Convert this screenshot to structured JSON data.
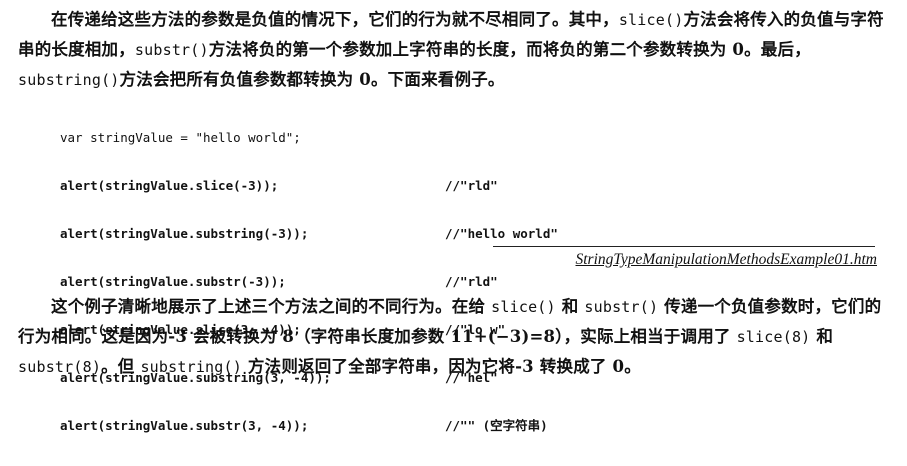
{
  "paragraph1": {
    "t1": "在传递给这些方法的参数是负值的情况下，它们的行为就不尽相同了。其中，",
    "c1": "slice()",
    "t2": "方法会将传入的负值与字符串的长度相加，",
    "c2": "substr()",
    "t3": "方法将负的第一个参数加上字符串的长度，而将负的第二个参数转换为 0。最后，",
    "c3": "substring()",
    "t4": "方法会把所有负值参数都转换为 0。下面来看例子。"
  },
  "code": {
    "lines": [
      {
        "stmt": "var stringValue = \"hello world\";",
        "comment": ""
      },
      {
        "stmt": "alert(stringValue.slice(-3));",
        "comment": "//\"rld\""
      },
      {
        "stmt": "alert(stringValue.substring(-3));",
        "comment": "//\"hello world\""
      },
      {
        "stmt": "alert(stringValue.substr(-3));",
        "comment": "//\"rld\""
      },
      {
        "stmt": "alert(stringValue.slice(3, -4));",
        "comment": "//\"lo w\""
      },
      {
        "stmt": "alert(stringValue.substring(3, -4));",
        "comment": "//\"hel\""
      },
      {
        "stmt": "alert(stringValue.substr(3, -4));",
        "comment": "//\"\" (空字符串)"
      }
    ]
  },
  "filename": "StringTypeManipulationMethodsExample01.htm",
  "paragraph2": {
    "t1": "这个例子清晰地展示了上述三个方法之间的不同行为。在给 ",
    "c1": "slice()",
    "t2": " 和 ",
    "c2": "substr()",
    "t3": " 传递一个负值参数时，它们的行为相同。这是因为-3 会被转换为 8（字符串长度加参数 11+(−3)=8），实际上相当于调用了 ",
    "c3": "slice(8)",
    "t4": " 和 ",
    "c4": "substr(8)",
    "t5": "。但 ",
    "c5": "substring()",
    "t6": " 方法则返回了全部字符串，因为它将-3 转换成了 0。"
  }
}
